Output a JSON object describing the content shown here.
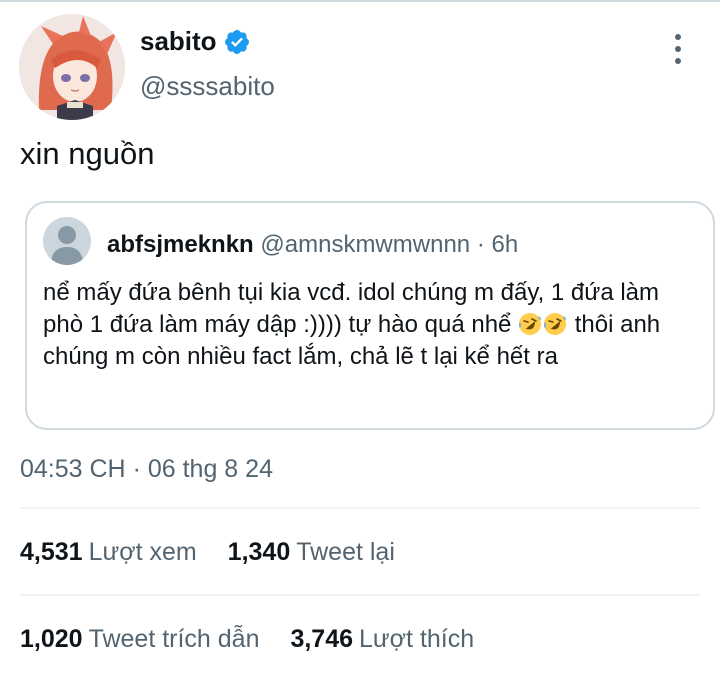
{
  "tweet": {
    "author_name": "sabito",
    "author_handle": "@ssssabito",
    "text": "xin nguồn",
    "timestamp": "04:53 CH",
    "separator": "·",
    "date": "06 thg 8 24"
  },
  "quoted": {
    "author_name": "abfsjmeknkn",
    "author_handle": "@amnskmwmwnnn",
    "separator": "·",
    "time": "6h",
    "text_part1": "nể mấy đứa bênh tụi kia vcđ. idol chúng m đấy, 1 đứa làm phò 1 đứa làm máy dập :)))) tự hào quá nhể ",
    "emojis": [
      "rofl-emoji",
      "rofl-emoji"
    ],
    "text_part2": " thôi anh chúng m còn nhiều fact lắm, chả lẽ t lại kể hết ra"
  },
  "stats": {
    "views_count": "4,531",
    "views_label": "Lượt xem",
    "retweets_count": "1,340",
    "retweets_label": "Tweet lại",
    "quotes_count": "1,020",
    "quotes_label": "Tweet trích dẫn",
    "likes_count": "3,746",
    "likes_label": "Lượt thích"
  },
  "icons": {
    "verified": "verified-badge-icon",
    "more": "more-options-icon",
    "default_avatar": "default-avatar-icon"
  },
  "colors": {
    "verified_blue": "#1d9bf0",
    "text_primary": "#0f1419",
    "text_secondary": "#536471",
    "border": "#cfd9de"
  }
}
